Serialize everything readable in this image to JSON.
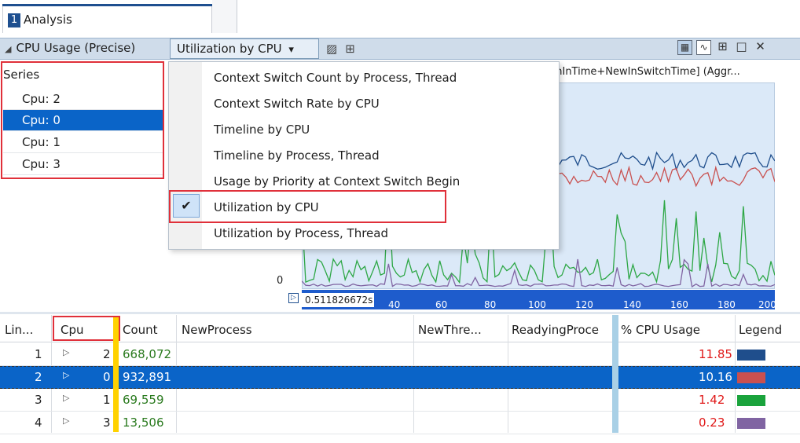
{
  "tab": {
    "number": "1",
    "title": "Analysis"
  },
  "toolbar": {
    "graph_title": "CPU Usage (Precise)",
    "preset_label": "Utilization by CPU",
    "preset_arrow": "▾"
  },
  "series": {
    "header": "Series",
    "items": [
      "Cpu: 2",
      "Cpu: 0",
      "Cpu: 1",
      "Cpu: 3"
    ],
    "selected_index": 1
  },
  "chart": {
    "title": "tchInTime+NewInSwitchTime] (Aggr...",
    "y_zero_label": "0",
    "x_start_label": "0.511826672s",
    "x_ticks": [
      "40",
      "60",
      "80",
      "100",
      "120",
      "140",
      "160",
      "180",
      "200"
    ],
    "series_colors": {
      "cpu2": "#1f4e8c",
      "cpu0": "#c9504f",
      "cpu1": "#2da745",
      "cpu3": "#8064a2"
    }
  },
  "menu": {
    "items": [
      "Context Switch Count by Process, Thread",
      "Context Switch Rate by CPU",
      "Timeline by CPU",
      "Timeline by Process, Thread",
      "Usage by Priority at Context Switch Begin",
      "Utilization by CPU",
      "Utilization by Process, Thread"
    ],
    "checked_index": 5,
    "check_glyph": "✔"
  },
  "grid": {
    "columns": [
      "Lin...",
      "Cpu",
      "Count",
      "NewProcess",
      "NewThre...",
      "ReadyingProce",
      "% CPU Usage",
      "Legend"
    ],
    "rows": [
      {
        "line": "1",
        "cpu": "2",
        "count": "668,072",
        "usage": "11.85",
        "color": "#1f4e8c"
      },
      {
        "line": "2",
        "cpu": "0",
        "count": "932,891",
        "usage": "10.16",
        "color": "#c9504f"
      },
      {
        "line": "3",
        "cpu": "1",
        "count": "69,559",
        "usage": "1.42",
        "color": "#1aa33c"
      },
      {
        "line": "4",
        "cpu": "3",
        "count": "13,506",
        "usage": "0.23",
        "color": "#8064a2"
      }
    ],
    "selected_row": 1
  }
}
